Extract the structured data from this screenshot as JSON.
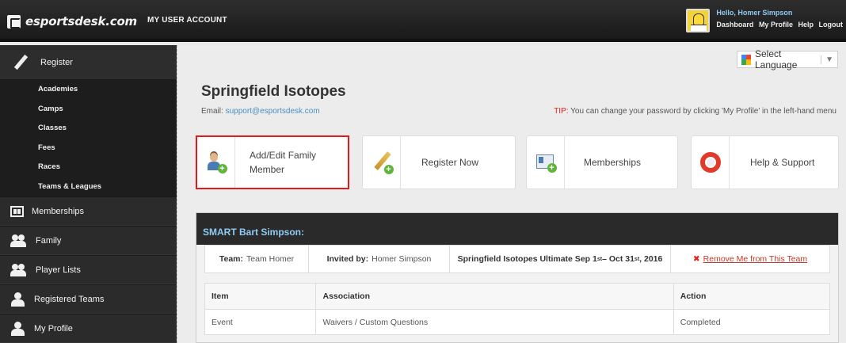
{
  "header": {
    "logo_text": "esportsdesk.com",
    "account_label": "MY USER ACCOUNT",
    "greeting": "Hello, Homer Simpson",
    "links": [
      "Dashboard",
      "My Profile",
      "Help",
      "Logout"
    ]
  },
  "sidebar": {
    "register_label": "Register",
    "register_subitems": [
      "Academies",
      "Camps",
      "Classes",
      "Fees",
      "Races",
      "Teams & Leagues"
    ],
    "items": [
      {
        "label": "Memberships",
        "icon": "membership-card-icon"
      },
      {
        "label": "Family",
        "icon": "family-icon"
      },
      {
        "label": "Player Lists",
        "icon": "player-lists-icon"
      },
      {
        "label": "Registered Teams",
        "icon": "person-icon"
      },
      {
        "label": "My Profile",
        "icon": "person-icon"
      }
    ]
  },
  "language_select": {
    "label": "Select Language",
    "arrow": "▼"
  },
  "main": {
    "title": "Springfield Isotopes",
    "email_label": "Email:",
    "email": "support@esportsdesk.com",
    "tip_label": "TIP:",
    "tip_text": "You can change your password by clicking 'My Profile' in the left-hand menu"
  },
  "actions": [
    {
      "label": "Add/Edit Family Member",
      "icon": "add-family-member-icon",
      "highlight_color": "#e21a1a"
    },
    {
      "label": "Register Now",
      "icon": "register-pencil-icon"
    },
    {
      "label": "Memberships",
      "icon": "membership-card-icon"
    },
    {
      "label": "Help & Support",
      "icon": "lifebuoy-icon"
    }
  ],
  "panel": {
    "heading": "SMART Bart Simpson:",
    "team_label": "Team:",
    "team_value": "Team Homer",
    "invited_label": "Invited by:",
    "invited_value": "Homer Simpson",
    "season_prefix": "Springfield Isotopes Ultimate Sep 1",
    "season_sup1": "st",
    "season_mid": " – Oct 31",
    "season_sup2": "st",
    "season_suffix": ", 2016",
    "remove_label": "Remove Me from This Team",
    "table": {
      "headers": [
        "Item",
        "Association",
        "Action"
      ],
      "rows": [
        [
          "Event",
          "Waivers / Custom Questions",
          "Completed"
        ]
      ]
    }
  }
}
